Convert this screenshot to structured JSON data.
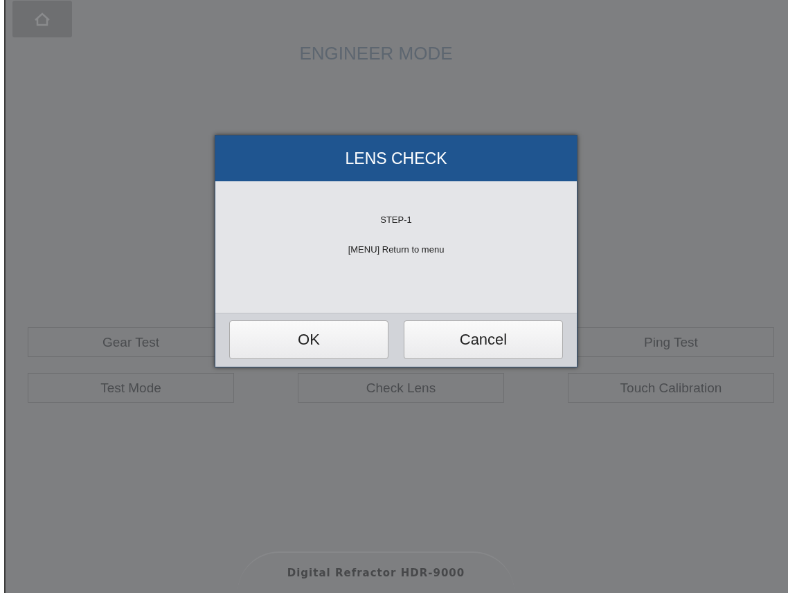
{
  "header": {
    "title": "ENGINEER MODE"
  },
  "menu_rows": [
    [
      "Gear Test",
      "Ping Test"
    ],
    [
      "Test Mode",
      "Check Lens",
      "Touch Calibration"
    ]
  ],
  "dialog": {
    "title": "LENS CHECK",
    "lines": [
      "STEP-1",
      "[MENU] Return to menu"
    ],
    "buttons": [
      "OK",
      "Cancel"
    ]
  },
  "footer": {
    "text": "Digital Refractor HDR-9000"
  }
}
